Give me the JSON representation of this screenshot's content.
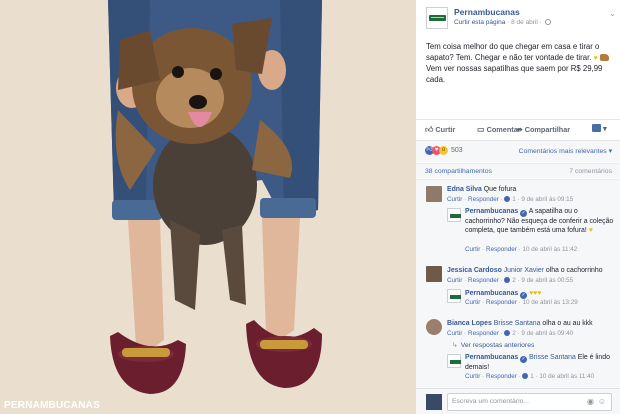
{
  "photo": {
    "watermark": "PERNAMBUCANAS",
    "alt": "dog photo"
  },
  "post": {
    "page_name": "Pernambucanas",
    "follow_link": "Curtir esta página",
    "date": "8 de abril",
    "text": "Tem coisa melhor do que chegar em casa e tirar o sapato? Tem. Chegar e não ter vontade de tirar.",
    "text2": "Vem ver nossas sapatilhas que saem por R$ 29,99 cada."
  },
  "actions": {
    "like": "Curtir",
    "comment": "Comentar",
    "share": "Compartilhar"
  },
  "reactions": {
    "count": "503",
    "sort": "Comentários mais relevantes ▾"
  },
  "stats": {
    "shares": "38 compartilhamentos",
    "comments": "7 comentários"
  },
  "comments": [
    {
      "name": "Edna Silva",
      "text": "Que fofura",
      "like": "Curtir",
      "reply": "Responder",
      "reactions": "1",
      "date": "9 de abril às 09:15"
    },
    {
      "name": "Pernambucanas",
      "text": "A sapatilha ou o cachorrinho? Não esqueça de conferir a coleção completa, que também está uma fofura!",
      "like": "Curtir",
      "reply": "Responder",
      "date": "10 de abril às 11:42"
    },
    {
      "name": "Jessica Cardoso",
      "mention": "Junior Xavier",
      "text": "olha o cachorrinho",
      "like": "Curtir",
      "reply": "Responder",
      "reactions": "2",
      "date": "9 de abril às 00:55"
    },
    {
      "name": "Pernambucanas",
      "like": "Curtir",
      "reply": "Responder",
      "date": "10 de abril às 13:29"
    },
    {
      "name": "Bianca Lopes",
      "mention": "Brisse Santana",
      "text": "olha o au au kkk",
      "like": "Curtir",
      "reply": "Responder",
      "reactions": "2",
      "date": "9 de abril às 09:40"
    },
    {
      "more": "Ver respostas anteriores"
    },
    {
      "name": "Pernambucanas",
      "mention": "Brisse Santana",
      "text": "Ele é lindo demais!",
      "like": "Curtir",
      "reply": "Responder",
      "reactions": "1",
      "date": "10 de abril às 11:40"
    }
  ],
  "composer": {
    "placeholder": "Escreva um comentário..."
  },
  "colors": {
    "link": "#365899",
    "accent": "#4267b2",
    "brand_green": "#1f6b3a"
  }
}
